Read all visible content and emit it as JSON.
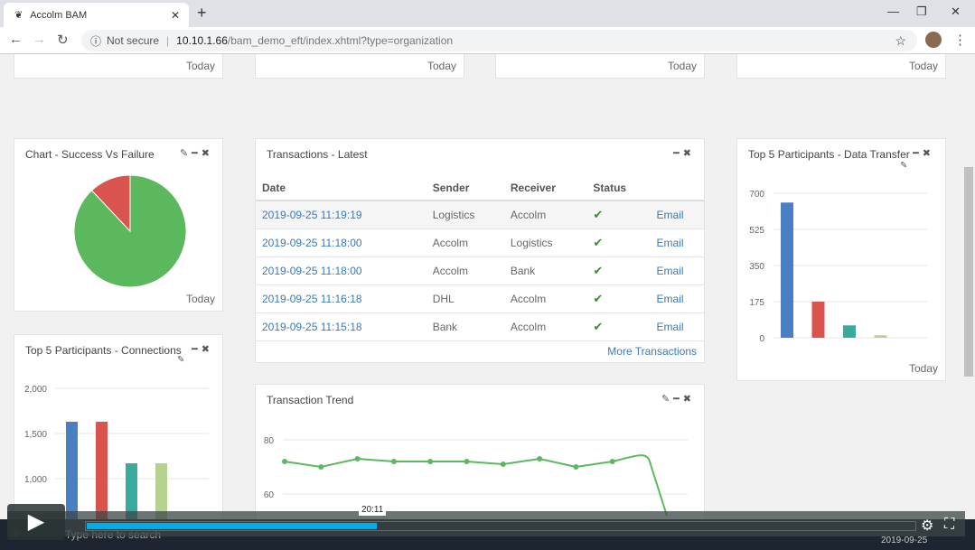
{
  "browser": {
    "tab_title": "Accolm BAM",
    "security": "Not secure",
    "url_host": "10.10.1.66",
    "url_path": "/bam_demo_eft/index.xhtml?type=organization"
  },
  "top_cards": [
    {
      "footer": "Today"
    },
    {
      "footer": "Today"
    },
    {
      "footer": "Today"
    },
    {
      "footer": "Today"
    }
  ],
  "success_chart": {
    "title": "Chart - Success Vs Failure",
    "footer": "Today",
    "chart_data": {
      "type": "pie",
      "slices": [
        {
          "label": "Success",
          "value": 88,
          "color": "#5cb85c"
        },
        {
          "label": "Failure",
          "value": 12,
          "color": "#d9534f"
        }
      ]
    }
  },
  "transactions": {
    "title": "Transactions - Latest",
    "columns": [
      "Date",
      "Sender",
      "Receiver",
      "Status",
      ""
    ],
    "rows": [
      {
        "date": "2019-09-25 11:19:19",
        "sender": "Logistics",
        "receiver": "Accolm",
        "status": "✔",
        "action": "Email"
      },
      {
        "date": "2019-09-25 11:18:00",
        "sender": "Accolm",
        "receiver": "Logistics",
        "status": "✔",
        "action": "Email"
      },
      {
        "date": "2019-09-25 11:18:00",
        "sender": "Accolm",
        "receiver": "Bank",
        "status": "✔",
        "action": "Email"
      },
      {
        "date": "2019-09-25 11:16:18",
        "sender": "DHL",
        "receiver": "Accolm",
        "status": "✔",
        "action": "Email"
      },
      {
        "date": "2019-09-25 11:15:18",
        "sender": "Bank",
        "receiver": "Accolm",
        "status": "✔",
        "action": "Email"
      }
    ],
    "more": "More Transactions"
  },
  "data_transfer": {
    "title": "Top 5 Participants - Data Transfer",
    "footer": "Today",
    "chart_data": {
      "type": "bar",
      "ylim": [
        0,
        700
      ],
      "yticks": [
        "0",
        "175",
        "350",
        "525",
        "700"
      ],
      "values": [
        655,
        175,
        60,
        12
      ],
      "colors": [
        "#4a7fc1",
        "#d9534f",
        "#3aaa9e",
        "#b5d38f"
      ]
    }
  },
  "connections": {
    "title": "Top 5 Participants - Connections",
    "chart_data": {
      "type": "bar",
      "ylim": [
        0,
        2000
      ],
      "yticks": [
        "500",
        "1,000",
        "1,500",
        "2,000"
      ],
      "values": [
        1630,
        1630,
        1170,
        1170
      ],
      "colors": [
        "#4a7fc1",
        "#d9534f",
        "#3aaa9e",
        "#b5d38f"
      ]
    }
  },
  "trend": {
    "title": "Transaction Trend",
    "chart_data": {
      "type": "line",
      "yticks": [
        "60",
        "80"
      ],
      "values": [
        72,
        70,
        73,
        72,
        72,
        72,
        71,
        73,
        70,
        72,
        72,
        52
      ],
      "color": "#5cb85c"
    }
  },
  "video": {
    "time_tooltip": "20:11",
    "progress_percent": 35,
    "taskbar_search": "Type here to search",
    "clock": "2019-09-25"
  }
}
